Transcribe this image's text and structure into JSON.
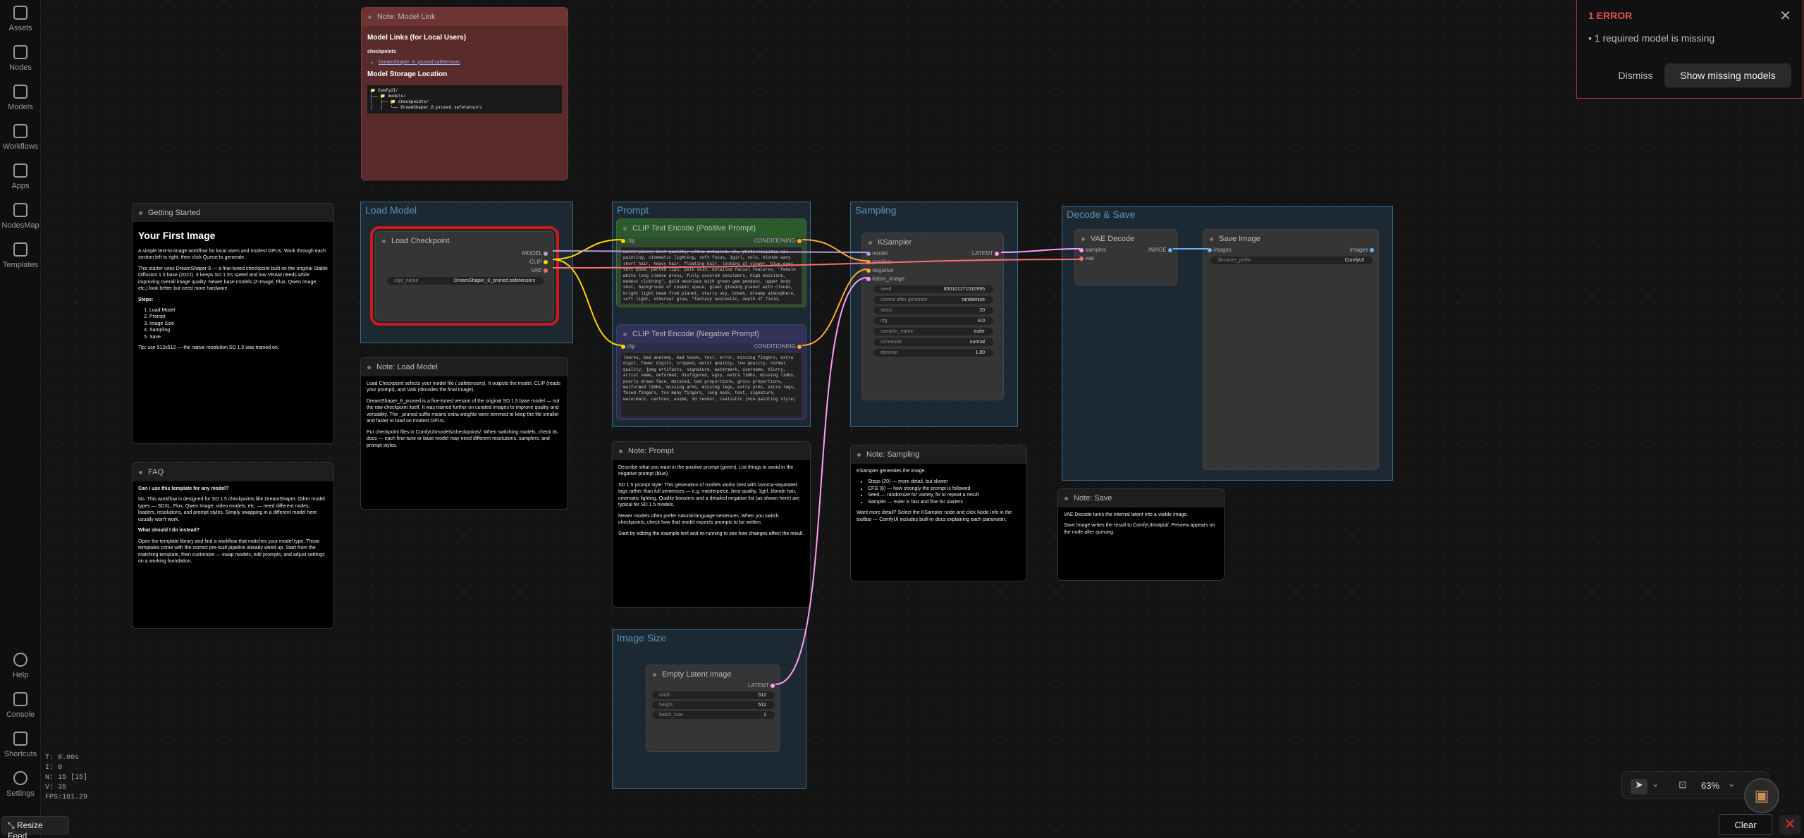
{
  "sidebar": {
    "items": [
      {
        "label": "Assets",
        "icon": "image-icon"
      },
      {
        "label": "Nodes",
        "icon": "nodes-icon"
      },
      {
        "label": "Models",
        "icon": "models-icon"
      },
      {
        "label": "Workflows",
        "icon": "workflow-icon"
      },
      {
        "label": "Apps",
        "icon": "apps-icon"
      },
      {
        "label": "NodesMap",
        "icon": "map-icon"
      },
      {
        "label": "Templates",
        "icon": "templates-icon"
      }
    ],
    "bottom": [
      {
        "label": "Help"
      },
      {
        "label": "Console"
      },
      {
        "label": "Shortcuts"
      },
      {
        "label": "Settings"
      }
    ]
  },
  "stats": [
    "T: 0.00s",
    "I: 0",
    "N: 15 [15]",
    "V: 35",
    "FPS:161.29"
  ],
  "resize_feed": "Resize Feed",
  "error": {
    "count": "1 ERROR",
    "message": "1 required model is missing",
    "dismiss": "Dismiss",
    "show": "Show missing models"
  },
  "toolbar": {
    "zoom": "63%",
    "clear": "Clear"
  },
  "groups": {
    "load_model": "Load Model",
    "prompt": "Prompt",
    "sampling": "Sampling",
    "decode_save": "Decode & Save",
    "image_size": "Image Size"
  },
  "notes": {
    "model_link": {
      "title": "Note: Model Link",
      "h1": "Model Links (for Local Users)",
      "checkpoints": "checkpoints",
      "link": "DreamShaper_8_pruned.safetensors",
      "h2": "Model Storage Location",
      "tree": [
        "📁 ComfyUI/",
        "├── 📁 models/",
        "│   ├── 📁 checkpoints/",
        "│   │   └── DreamShaper_8_pruned.safetensors"
      ]
    },
    "getting_started": {
      "title": "Getting Started",
      "h1": "Your First Image",
      "p1": "A simple text-to-image workflow for local users and modest GPUs. Work through each section left to right, then click Queue to generate.",
      "p2": "This starter uses DreamShaper 8 — a fine-tuned checkpoint built on the original Stable Diffusion 1.5 base (2022). It keeps SD 1.5's speed and low VRAM needs while improving overall image quality. Newer base models (Z-Image, Flux, Qwen Image, etc.) look better but need more hardware.",
      "steps_label": "Steps:",
      "steps": [
        "Load Model",
        "Prompt",
        "Image Size",
        "Sampling",
        "Save"
      ],
      "tip": "Tip: use 512x512 — the native resolution SD 1.5 was trained on."
    },
    "faq": {
      "title": "FAQ",
      "q1": "Can I use this template for any model?",
      "a1": "No. This workflow is designed for SD 1.5 checkpoints like DreamShaper. Other model types — SDXL, Flux, Qwen Image, video models, etc. — need different nodes, loaders, resolutions, and prompt styles. Simply swapping in a different model here usually won't work.",
      "q2": "What should I do instead?",
      "a2": "Open the template library and find a workflow that matches your model type. Those templates come with the correct pre-built pipeline already wired up. Start from the matching template, then customize — swap models, edit prompts, and adjust settings on a working foundation."
    },
    "load_model": {
      "title": "Note: Load Model",
      "p1": "Load Checkpoint selects your model file (.safetensors). It outputs the model, CLIP (reads your prompt), and VAE (decodes the final image).",
      "p2": "DreamShaper_8_pruned is a fine-tuned version of the original SD 1.5 base model — not the raw checkpoint itself. It was trained further on curated images to improve quality and versatility. The _pruned suffix means extra weights were trimmed to keep the file smaller and faster to load on modest GPUs.",
      "p3": "Put checkpoint files in ComfyUI/models/checkpoints/. When switching models, check its docs — each fine-tune or base model may need different resolutions, samplers, and prompt styles."
    },
    "prompt": {
      "title": "Note: Prompt",
      "p1": "Describe what you want in the positive prompt (green). List things to avoid in the negative prompt (blue).",
      "p2": "SD 1.5 prompt style: This generation of models works best with comma-separated tags rather than full sentences — e.g. masterpiece, best quality, 1girl, blonde hair, cinematic lighting. Quality boosters and a detailed negative list (as shown here) are typical for SD 1.5 models.",
      "p3": "Newer models often prefer natural-language sentences. When you switch checkpoints, check how that model expects prompts to be written.",
      "p4": "Start by editing the example text and re-running to see how changes affect the result."
    },
    "sampling": {
      "title": "Note: Sampling",
      "p1": "KSampler generates the image.",
      "items": [
        "Steps (20) — more detail, but slower",
        "CFG (8) — how strongly the prompt is followed",
        "Seed — randomize for variety, fix to repeat a result",
        "Sampler — euler is fast and fine for starters"
      ],
      "p2": "Want more detail? Select the KSampler node and click Node Info in the toolbar — ComfyUI includes built-in docs explaining each parameter."
    },
    "save": {
      "title": "Note: Save",
      "p1": "VAE Decode turns the internal latent into a visible image.",
      "p2": "Save Image writes the result to ComfyUI/output/. Preview appears on the node after queuing."
    }
  },
  "nodes": {
    "load_checkpoint": {
      "title": "Load Checkpoint",
      "outputs": [
        "MODEL",
        "CLIP",
        "VAE"
      ],
      "widget_label": "ckpt_name",
      "widget_value": "DreamShaper_8_pruned.safetensors"
    },
    "clip_pos": {
      "title": "CLIP Text Encode (Positive Prompt)",
      "input": "clip",
      "output": "CONDITIONING",
      "text": "masterpiece, best quality, ultra-detailed, 8k, photorealistic oil painting, cinematic lighting, soft focus, 1girl, solo, blonde wavy short hair, heavy hair, floating hair, looking at viewer, blue eyes, soft pose, parted lips, pale skin, detailed facial features, \"female white long sleeve dress, fully covered shoulders, high neckline, modest clothing\", gold necklace with green gem pendant, upper body shot, background of cosmic space, giant glowing planet with clouds, bright light beam from planet, starry sky, bokeh, dreamy atmosphere, soft light, ethereal glow, \"fantasy aesthetic, depth of field, painterly details,\""
    },
    "clip_neg": {
      "title": "CLIP Text Encode (Negative Prompt)",
      "input": "clip",
      "output": "CONDITIONING",
      "text": "lowres, bad anatomy, bad hands, text, error, missing fingers, extra digit, fewer digits, cropped, worst quality, low quality, normal quality, jpeg artifacts, signature, watermark, username, blurry, artist name, deformed, disfigured, ugly, extra limbs, missing limbs, poorly drawn face, mutated, bad proportions, gross proportions, malformed limbs, missing arms, missing legs, extra arms, extra legs, fused fingers, too many fingers, long neck, text, signature, watermark, cartoon, anime, 3d render, realistic (non-painting style)"
    },
    "ksampler": {
      "title": "KSampler",
      "inputs": [
        "model",
        "positive",
        "negative",
        "latent_image"
      ],
      "output": "LATENT",
      "widgets": [
        [
          "seed",
          "850101271510995"
        ],
        [
          "control after generate",
          "randomize"
        ],
        [
          "steps",
          "20"
        ],
        [
          "cfg",
          "8.0"
        ],
        [
          "sampler_name",
          "euler"
        ],
        [
          "scheduler",
          "normal"
        ],
        [
          "denoise",
          "1.00"
        ]
      ]
    },
    "vae_decode": {
      "title": "VAE Decode",
      "inputs": [
        "samples",
        "vae"
      ],
      "output": "IMAGE"
    },
    "save_image": {
      "title": "Save Image",
      "input": "images",
      "output": "images",
      "widget_label": "filename_prefix",
      "widget_value": "ComfyUI"
    },
    "empty_latent": {
      "title": "Empty Latent Image",
      "output": "LATENT",
      "widgets": [
        [
          "width",
          "512"
        ],
        [
          "height",
          "512"
        ],
        [
          "batch_size",
          "1"
        ]
      ]
    }
  }
}
